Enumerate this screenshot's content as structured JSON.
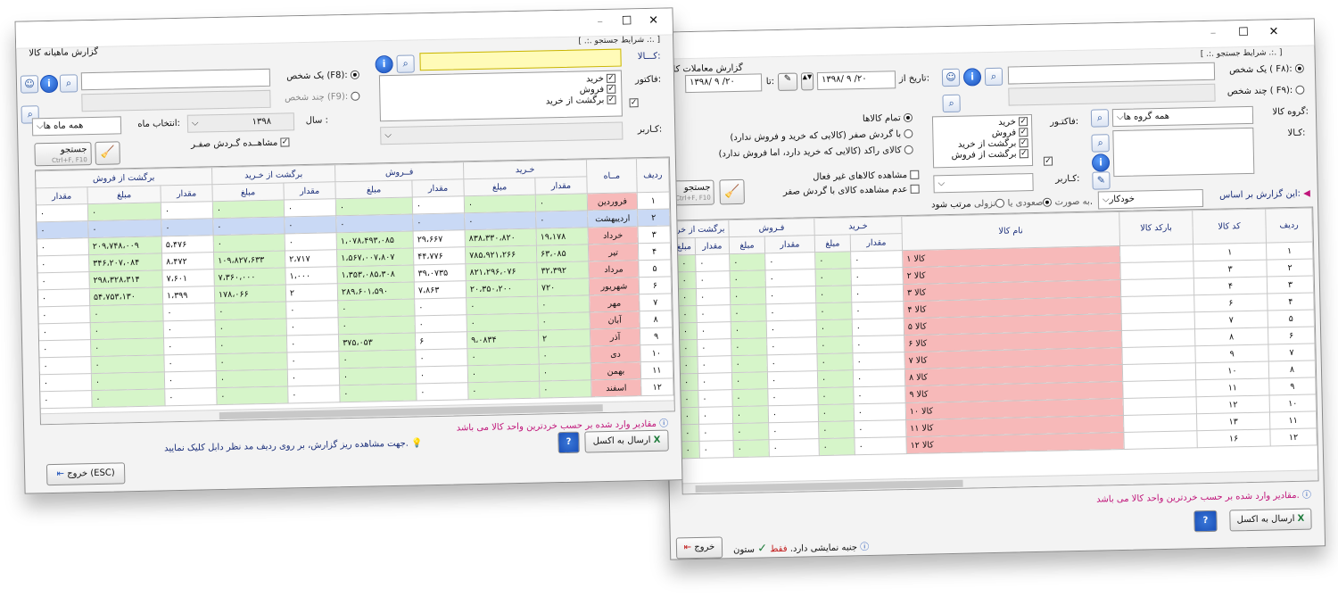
{
  "left_window": {
    "title": "گزارش ماهیانه کالا",
    "controls": {
      "close": "✕",
      "maximize": "☐",
      "minimize": "–"
    },
    "search_group_caption": "[ .:. شرایط جستجو .:. ]",
    "product_label": "کـــالا:",
    "product_value": "",
    "single_person_label": "یک شخص (F8):",
    "multi_person_label": "چند شخص (F9):",
    "invoice_label": "فاکتور:",
    "invoice_types": [
      "خرید",
      "فروش",
      "برگشت از خرید"
    ],
    "user_label": "کـاربر:",
    "year_label": "سال :",
    "year_value": "۱۳۹۸",
    "month_label": "انتخاب ماه:",
    "month_value": "همه ماه ها",
    "zero_turnover_label": "مشاهــده گـردش صفـر",
    "search_button": "جستجو",
    "search_shortcut": "Ctrl+F, F10",
    "columns": {
      "row": "ردیف",
      "month": "مــاه",
      "buy": "خـرید",
      "sell": "فــروش",
      "return_buy": "برگشت از خـرید",
      "return_sell": "برگشت از فروش",
      "qty": "مقدار",
      "amount": "مبلغ"
    },
    "rows": [
      {
        "n": "۱",
        "month": "فروردین",
        "bq": "۰",
        "ba": "۰",
        "sq": "۰",
        "sa": "۰",
        "rbq": "۰",
        "rba": "۰",
        "rsq": "۰",
        "rsa": "۰",
        "rsq2": "۰"
      },
      {
        "n": "۲",
        "month": "اردیبهشت",
        "bq": "۰",
        "ba": "۰",
        "sq": "۰",
        "sa": "۰",
        "rbq": "۰",
        "rba": "۰",
        "rsq": "۰",
        "rsa": "۰",
        "rsq2": "۰"
      },
      {
        "n": "۳",
        "month": "خرداد",
        "bq": "۱۹،۱۷۸",
        "ba": "۸۳۸،۳۳۰،۸۲۰",
        "sq": "۲۹،۶۶۷",
        "sa": "۱،۰۷۸،۴۹۳،۰۸۵",
        "rbq": "۰",
        "rba": "۰",
        "rsq": "۵،۴۷۶",
        "rsa": "۲۰۹،۷۴۸،۰۰۹",
        "rsq2": "۰"
      },
      {
        "n": "۴",
        "month": "تیر",
        "bq": "۶۳،۰۸۵",
        "ba": "۷۸۵،۹۲۱،۲۶۶",
        "sq": "۴۴،۷۷۶",
        "sa": "۱،۵۶۷،۰۰۷،۸۰۷",
        "rbq": "۲،۷۱۷",
        "rba": "۱۰۹،۸۲۷،۶۳۳",
        "rsq": "۸،۴۷۲",
        "rsa": "۳۴۶،۲۰۷،۰۸۴",
        "rsq2": "۰"
      },
      {
        "n": "۵",
        "month": "مرداد",
        "bq": "۳۲،۳۹۲",
        "ba": "۸۲۱،۲۹۶،۰۷۶",
        "sq": "۳۹،۰۷۳۵",
        "sa": "۱،۳۵۳،۰۸۵،۳۰۸",
        "rbq": "۱،۰۰۰",
        "rba": "۷،۳۶۰،۰۰۰",
        "rsq": "۷،۶۰۱",
        "rsa": "۲۹۸،۳۲۸،۳۱۴",
        "rsq2": "۰"
      },
      {
        "n": "۶",
        "month": "شهریور",
        "bq": "۷۲۰",
        "ba": "۲۰،۳۵۰،۲۰۰",
        "sq": "۷،۸۶۳",
        "sa": "۲۸۹،۶۰۱،۵۹۰",
        "rbq": "۲",
        "rba": "۱۷۸،۰۶۶",
        "rsq": "۱،۳۹۹",
        "rsa": "۵۴،۷۵۳،۱۳۰",
        "rsq2": "۰"
      },
      {
        "n": "۷",
        "month": "مهر",
        "bq": "۰",
        "ba": "۰",
        "sq": "۰",
        "sa": "۰",
        "rbq": "۰",
        "rba": "۰",
        "rsq": "۰",
        "rsa": "۰",
        "rsq2": "۰"
      },
      {
        "n": "۸",
        "month": "آبان",
        "bq": "۰",
        "ba": "۰",
        "sq": "۰",
        "sa": "۰",
        "rbq": "۰",
        "rba": "۰",
        "rsq": "۰",
        "rsa": "۰",
        "rsq2": "۰"
      },
      {
        "n": "۹",
        "month": "آذر",
        "bq": "۲",
        "ba": "۹،۰۸۳۴",
        "sq": "۶",
        "sa": "۳۷۵،۰۵۳",
        "rbq": "۰",
        "rba": "۰",
        "rsq": "۰",
        "rsa": "۰",
        "rsq2": "۰"
      },
      {
        "n": "۱۰",
        "month": "دی",
        "bq": "۰",
        "ba": "۰",
        "sq": "۰",
        "sa": "۰",
        "rbq": "۰",
        "rba": "۰",
        "rsq": "۰",
        "rsa": "۰",
        "rsq2": "۰"
      },
      {
        "n": "۱۱",
        "month": "بهمن",
        "bq": "۰",
        "ba": "۰",
        "sq": "۰",
        "sa": "۰",
        "rbq": "۰",
        "rba": "۰",
        "rsq": "۰",
        "rsa": "۰",
        "rsq2": "۰"
      },
      {
        "n": "۱۲",
        "month": "اسفند",
        "bq": "۰",
        "ba": "۰",
        "sq": "۰",
        "sa": "۰",
        "rbq": "۰",
        "rba": "۰",
        "rsq": "۰",
        "rsa": "۰",
        "rsq2": "۰"
      }
    ],
    "note_units": "مقادیر وارد شده بر حسب خردترین واحد کالا می باشد",
    "note_detail": "جهت مشاهده ریز گزارش، بر روی ردیف مد نظر دابل کلیک نمایید.",
    "excel_button": "ارسال به اکسل",
    "help_button": "?",
    "exit_button": "خروج (ESC)"
  },
  "right_window": {
    "title": "گزارش معاملات کالا",
    "controls": {
      "close": "✕",
      "maximize": "☐",
      "minimize": "–"
    },
    "search_group_caption": "[ .:. شرایط جستجو .:. ]",
    "single_person_label": "یک شخص ( F۸):",
    "multi_person_label": "چند شخص ( F۹):",
    "date_from_label": "تاریخ از:",
    "date_from": "۱۳۹۸/ ۹ /۲۰",
    "date_to_label": "تا:",
    "date_to": "۱۳۹۸/ ۹ /۲۰",
    "group_label": "گروه کالا:",
    "group_value": "همه گروه ها",
    "invoice_label": "فاکتـور:",
    "invoice_types": [
      "خرید",
      "فروش",
      "برگشت از خرید",
      "برگشت از فروش"
    ],
    "product_label": "کـالا:",
    "user_label": "کـاربر:",
    "all_products": "تمام کالاها",
    "zero_turnover": "با گردش صفر (کالایی که خرید و فروش ندارد)",
    "stagnant": "کالای راکد (کالایی که خرید دارد، اما فروش ندارد)",
    "inactive": "مشاهده کالاهای غیر فعال",
    "hide_zero": "عدم مشاهده کالای با گردش صفر",
    "report_basis_label": "این گزارش بر اساس:",
    "report_basis_value": "خودکار",
    "order_as": "به صورت",
    "ascending": "صعودی",
    "descending": "نزولی",
    "order_suffix": "مرتب شود.",
    "search_button": "جستجو",
    "search_shortcut": "Ctrl+F, F10",
    "columns": {
      "row": "ردیف",
      "code": "کد کالا",
      "barcode": "بارکد کالا",
      "name": "نام کالا",
      "buy": "خـرید",
      "sell": "فـروش",
      "return_buy": "برگشت از خرید",
      "qty": "مقدار",
      "amount": "مبلغ"
    },
    "rows": [
      {
        "n": "۱",
        "code": "۱",
        "name": "کالا ۱"
      },
      {
        "n": "۲",
        "code": "۳",
        "name": "کالا ۲"
      },
      {
        "n": "۳",
        "code": "۴",
        "name": "کالا ۳"
      },
      {
        "n": "۴",
        "code": "۶",
        "name": "کالا ۴"
      },
      {
        "n": "۵",
        "code": "۷",
        "name": "کالا ۵"
      },
      {
        "n": "۶",
        "code": "۸",
        "name": "کالا ۶"
      },
      {
        "n": "۷",
        "code": "۹",
        "name": "کالا ۷"
      },
      {
        "n": "۸",
        "code": "۱۰",
        "name": "کالا ۸"
      },
      {
        "n": "۹",
        "code": "۱۱",
        "name": "کالا ۹"
      },
      {
        "n": "۱۰",
        "code": "۱۲",
        "name": "کالا ۱۰"
      },
      {
        "n": "۱۱",
        "code": "۱۳",
        "name": "کالا ۱۱"
      },
      {
        "n": "۱۲",
        "code": "۱۶",
        "name": "کالا ۱۲"
      }
    ],
    "zero": "۰",
    "note_units": "مقادیر وارد شده بر حسب خردترین واحد کالا می باشد.",
    "excel_button": "ارسال به اکسل",
    "help_button": "?",
    "exit_button": "خروج",
    "column_hint_prefix": "ستون",
    "column_hint_only": "فقط",
    "column_hint_suffix": "جنبه نمایشی دارد."
  }
}
